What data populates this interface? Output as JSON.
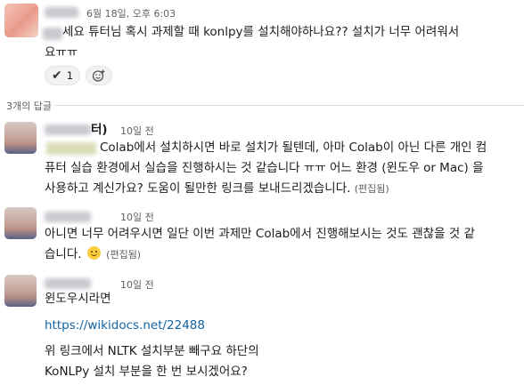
{
  "messages": [
    {
      "timestamp": "6월 18일, 오후 6:03",
      "lines": [
        "세요 튜터님 혹시 과제할 때 konlpy를 설치해야하나요?? 설치가 너무 어려워서",
        "요ㅠㅠ"
      ],
      "reactions": [
        {
          "emoji": "✔️",
          "count": "1"
        }
      ]
    }
  ],
  "replies_label": "3개의 답글",
  "replies": [
    {
      "name_suffix": "터)",
      "timestamp": "10일 전",
      "lines": [
        "Colab에서 설치하시면 바로 설치가 될텐데, 아마 Colab이 아닌 다른 개인 컴",
        "퓨터 실습 환경에서 실습을 진행하시는 것 같습니다 ㅠㅠ 어느 환경 (윈도우 or Mac) 을",
        "사용하고 계신가요? 도움이 될만한 링크를 보내드리겠습니다."
      ],
      "edited": "(편집됨)"
    },
    {
      "timestamp": "10일 전",
      "lines": [
        "아니면 너무 어려우시면 일단 이번 과제만 Colab에서 진행해보시는 것도 괜찮을 것 같",
        "습니다."
      ],
      "edited": "(편집됨)"
    },
    {
      "timestamp": "10일 전",
      "lines": [
        "윈도우시라면"
      ],
      "link": "https://wikidocs.net/22488",
      "extra_lines": [
        "위 링크에서 NLTK 설치부분 빼구요 하단의",
        "KoNLPy 설치 부분을 한 번 보시겠어요?"
      ]
    }
  ],
  "icons": {
    "reaction_check": "check-mark-emoji",
    "add_reaction": "add-reaction-icon",
    "smiley": "slightly-smiling-face-emoji"
  }
}
